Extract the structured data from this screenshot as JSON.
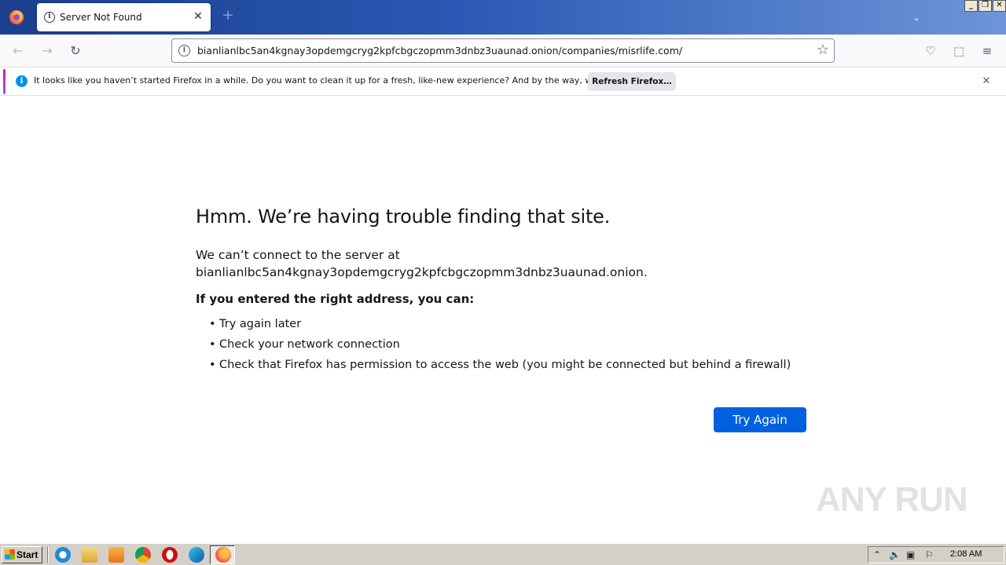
{
  "browser": {
    "tab_title": "Server Not Found",
    "new_tab_symbol": "+",
    "url": "bianlianlbc5an4kgnay3opdemgcryg2kpfcbgczopmm3dnbz3uaunad.onion/companies/misrlife.com/"
  },
  "notification": {
    "text": "It looks like you haven’t started Firefox in a while. Do you want to clean it up for a fresh, like-new experience? And by the way, welcome back!",
    "button_label": "Refresh Firefox…"
  },
  "error_page": {
    "title": "Hmm. We’re having trouble finding that site.",
    "desc_line1": "We can’t connect to the server at",
    "desc_line2": "bianlianlbc5an4kgnay3opdemgcryg2kpfcbgczopmm3dnbz3uaunad.onion.",
    "subtitle": "If you entered the right address, you can:",
    "suggestions": [
      "Try again later",
      "Check your network connection",
      "Check that Firefox has permission to access the web (you might be connected but behind a firewall)"
    ],
    "try_again_label": "Try Again"
  },
  "watermark": "ANY RUN",
  "taskbar": {
    "start_label": "Start",
    "clock": "2:08 AM"
  },
  "colors": {
    "accent_blue": "#0061e0",
    "info_blue": "#0090ed",
    "titlebar": "#2a58b4"
  },
  "icons": [
    "firefox-logo-icon",
    "info-icon",
    "close-icon",
    "back-arrow-icon",
    "forward-arrow-icon",
    "reload-icon",
    "bookmark-star-icon",
    "pocket-icon",
    "extensions-icon",
    "hamburger-menu-icon",
    "windows-flag-icon"
  ]
}
